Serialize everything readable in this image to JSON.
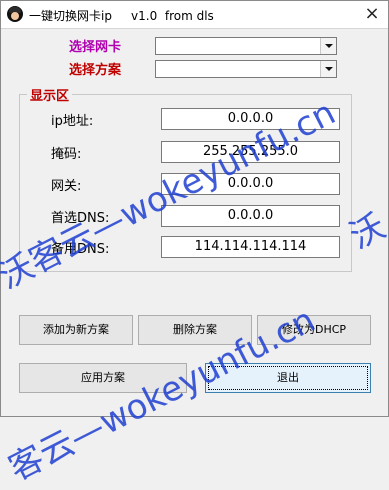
{
  "window": {
    "title": "一键切换网卡ip     v1.0  from dls",
    "close_glyph": "×"
  },
  "top": {
    "nic_label": "选择网卡",
    "plan_label": "选择方案",
    "nic_value": "",
    "plan_value": ""
  },
  "display": {
    "group_title": "显示区",
    "fields": [
      {
        "label": "ip地址:",
        "value": "0.0.0.0"
      },
      {
        "label": "掩码:",
        "value": "255.255.255.0"
      },
      {
        "label": "网关:",
        "value": "0.0.0.0"
      },
      {
        "label": "首选DNS:",
        "value": "0.0.0.0"
      },
      {
        "label": "备用DNS:",
        "value": "114.114.114.114"
      }
    ]
  },
  "buttons": {
    "add_plan": "添加为新方案",
    "delete_plan": "删除方案",
    "set_dhcp": "修改为DHCP",
    "apply_plan": "应用方案",
    "exit": "退出"
  },
  "watermark": {
    "text_main": "沃客云—wokeyunfu.cn",
    "text_lower": "客云—wokeyunfu.cn",
    "text_right": "沃"
  },
  "colors": {
    "top_label": "#b000b0",
    "section_label": "#c00000",
    "watermark": "#1f3fd1"
  }
}
